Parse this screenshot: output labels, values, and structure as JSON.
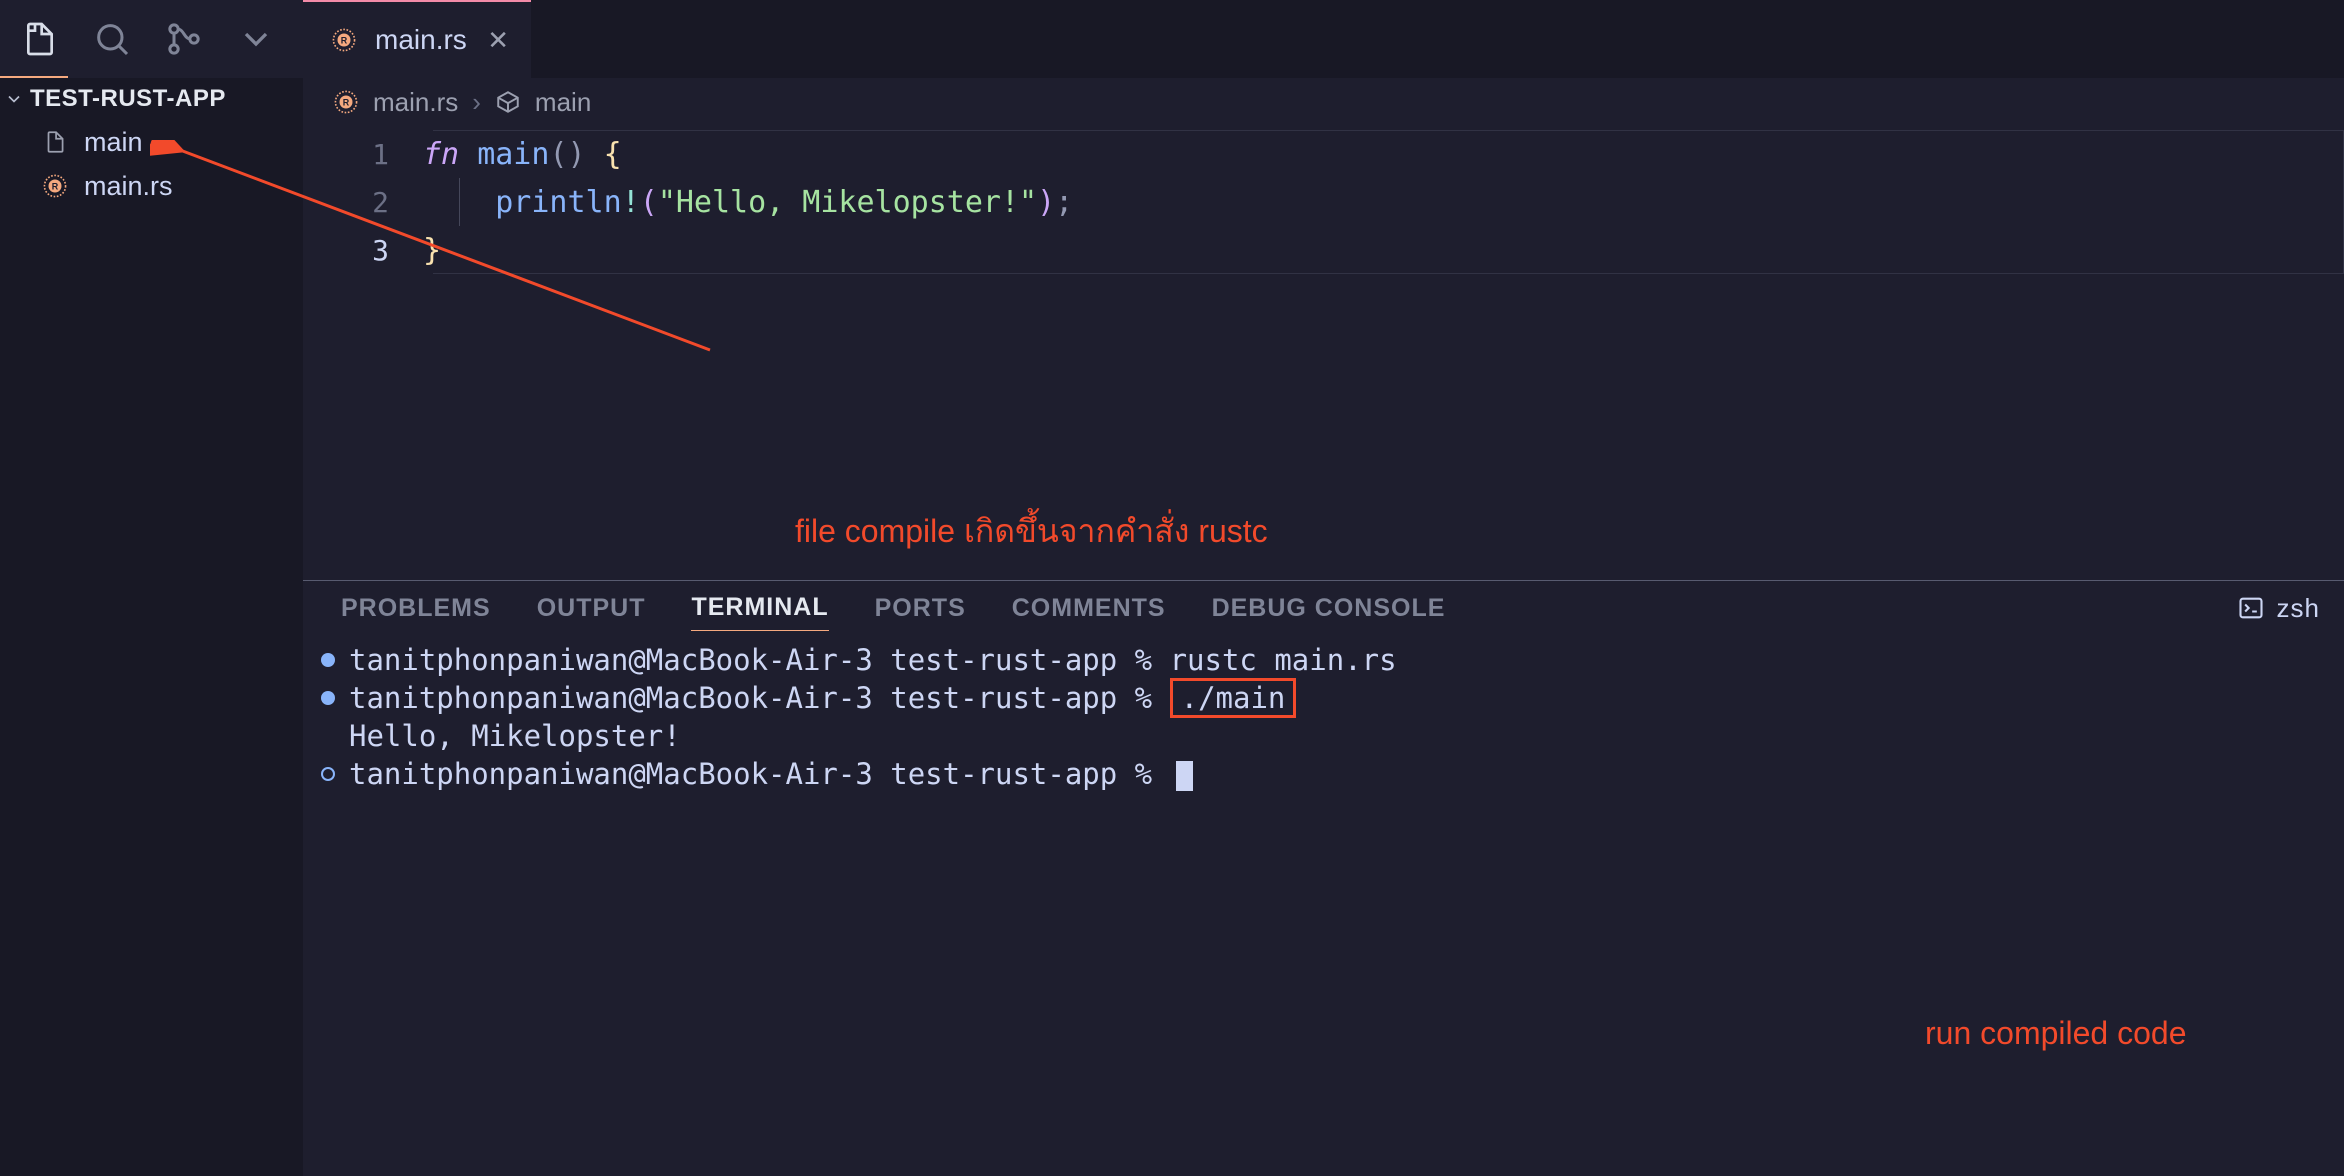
{
  "activity": {
    "explorer_active": true
  },
  "sidebar": {
    "project_name": "TEST-RUST-APP",
    "files": [
      {
        "name": "main",
        "icon": "file"
      },
      {
        "name": "main.rs",
        "icon": "rust"
      }
    ]
  },
  "tab": {
    "label": "main.rs"
  },
  "breadcrumb": {
    "file": "main.rs",
    "symbol": "main"
  },
  "code": {
    "lines": [
      {
        "n": "1",
        "tokens": [
          [
            "kw",
            "fn "
          ],
          [
            "fnname",
            "main"
          ],
          [
            "punct",
            "()"
          ],
          [
            "plain",
            " "
          ],
          [
            "brace",
            "{"
          ]
        ]
      },
      {
        "n": "2",
        "tokens": [
          [
            "plain",
            "    "
          ],
          [
            "macro",
            "println"
          ],
          [
            "bang",
            "!"
          ],
          [
            "paren",
            "("
          ],
          [
            "str",
            "\"Hello, Mikelopster!\""
          ],
          [
            "paren",
            ")"
          ],
          [
            "semi",
            ";"
          ]
        ]
      },
      {
        "n": "3",
        "tokens": [
          [
            "brace",
            "}"
          ]
        ]
      }
    ],
    "current_line_index": 2
  },
  "panel": {
    "tabs": [
      "PROBLEMS",
      "OUTPUT",
      "TERMINAL",
      "PORTS",
      "COMMENTS",
      "DEBUG CONSOLE"
    ],
    "active_tab": 2,
    "shell_label": "zsh"
  },
  "terminal": {
    "prompt": "tanitphonpaniwan@MacBook-Air-3 test-rust-app % ",
    "cmd1": "rustc main.rs",
    "cmd2": "./main",
    "output": "Hello, Mikelopster!"
  },
  "annotations": {
    "text1": "file compile เกิดขึ้นจากคำสั่ง rustc",
    "text2": "run compiled code"
  }
}
